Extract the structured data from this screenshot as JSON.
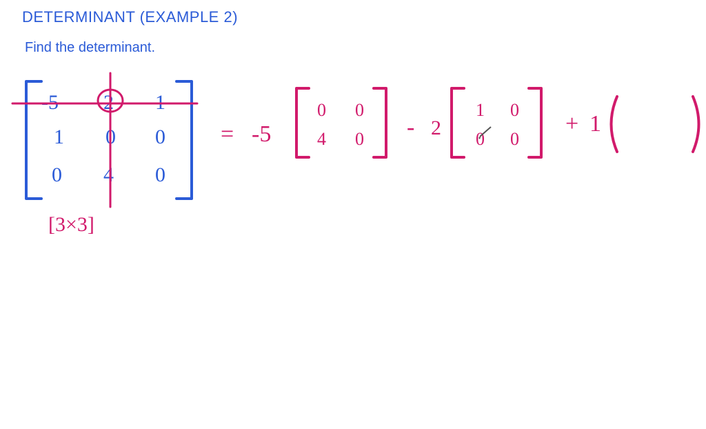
{
  "header": {
    "title": "DETERMINANT (EXAMPLE 2)",
    "subtitle": "Find the determinant."
  },
  "matrix": {
    "rows": [
      [
        "-5",
        "2",
        "1"
      ],
      [
        "1",
        "0",
        "0"
      ],
      [
        "0",
        "4",
        "0"
      ]
    ],
    "size_label": "[3×3]"
  },
  "expansion": {
    "eq": "=",
    "terms": [
      {
        "coef": "-5",
        "minor": [
          [
            "0",
            "0"
          ],
          [
            "4",
            "0"
          ]
        ]
      },
      {
        "op": "-",
        "coef": "2",
        "minor": [
          [
            "1",
            "0"
          ],
          [
            "0",
            "0"
          ]
        ]
      },
      {
        "op": "+",
        "coef": "1",
        "minor": [
          [
            "",
            ""
          ],
          [
            "",
            ""
          ]
        ]
      }
    ]
  },
  "colors": {
    "blue": "#2b5bd7",
    "magenta": "#d11a6b"
  },
  "chart_data": {
    "type": "table",
    "title": "3×3 matrix and first-row cofactor expansion",
    "matrix": [
      [
        -5,
        2,
        1
      ],
      [
        1,
        0,
        0
      ],
      [
        0,
        4,
        0
      ]
    ],
    "expansion_row": 0,
    "terms": [
      {
        "sign": 1,
        "coef": -5,
        "minor": [
          [
            0,
            0
          ],
          [
            4,
            0
          ]
        ]
      },
      {
        "sign": -1,
        "coef": 2,
        "minor": [
          [
            1,
            0
          ],
          [
            0,
            0
          ]
        ]
      },
      {
        "sign": 1,
        "coef": 1,
        "minor": null
      }
    ]
  }
}
